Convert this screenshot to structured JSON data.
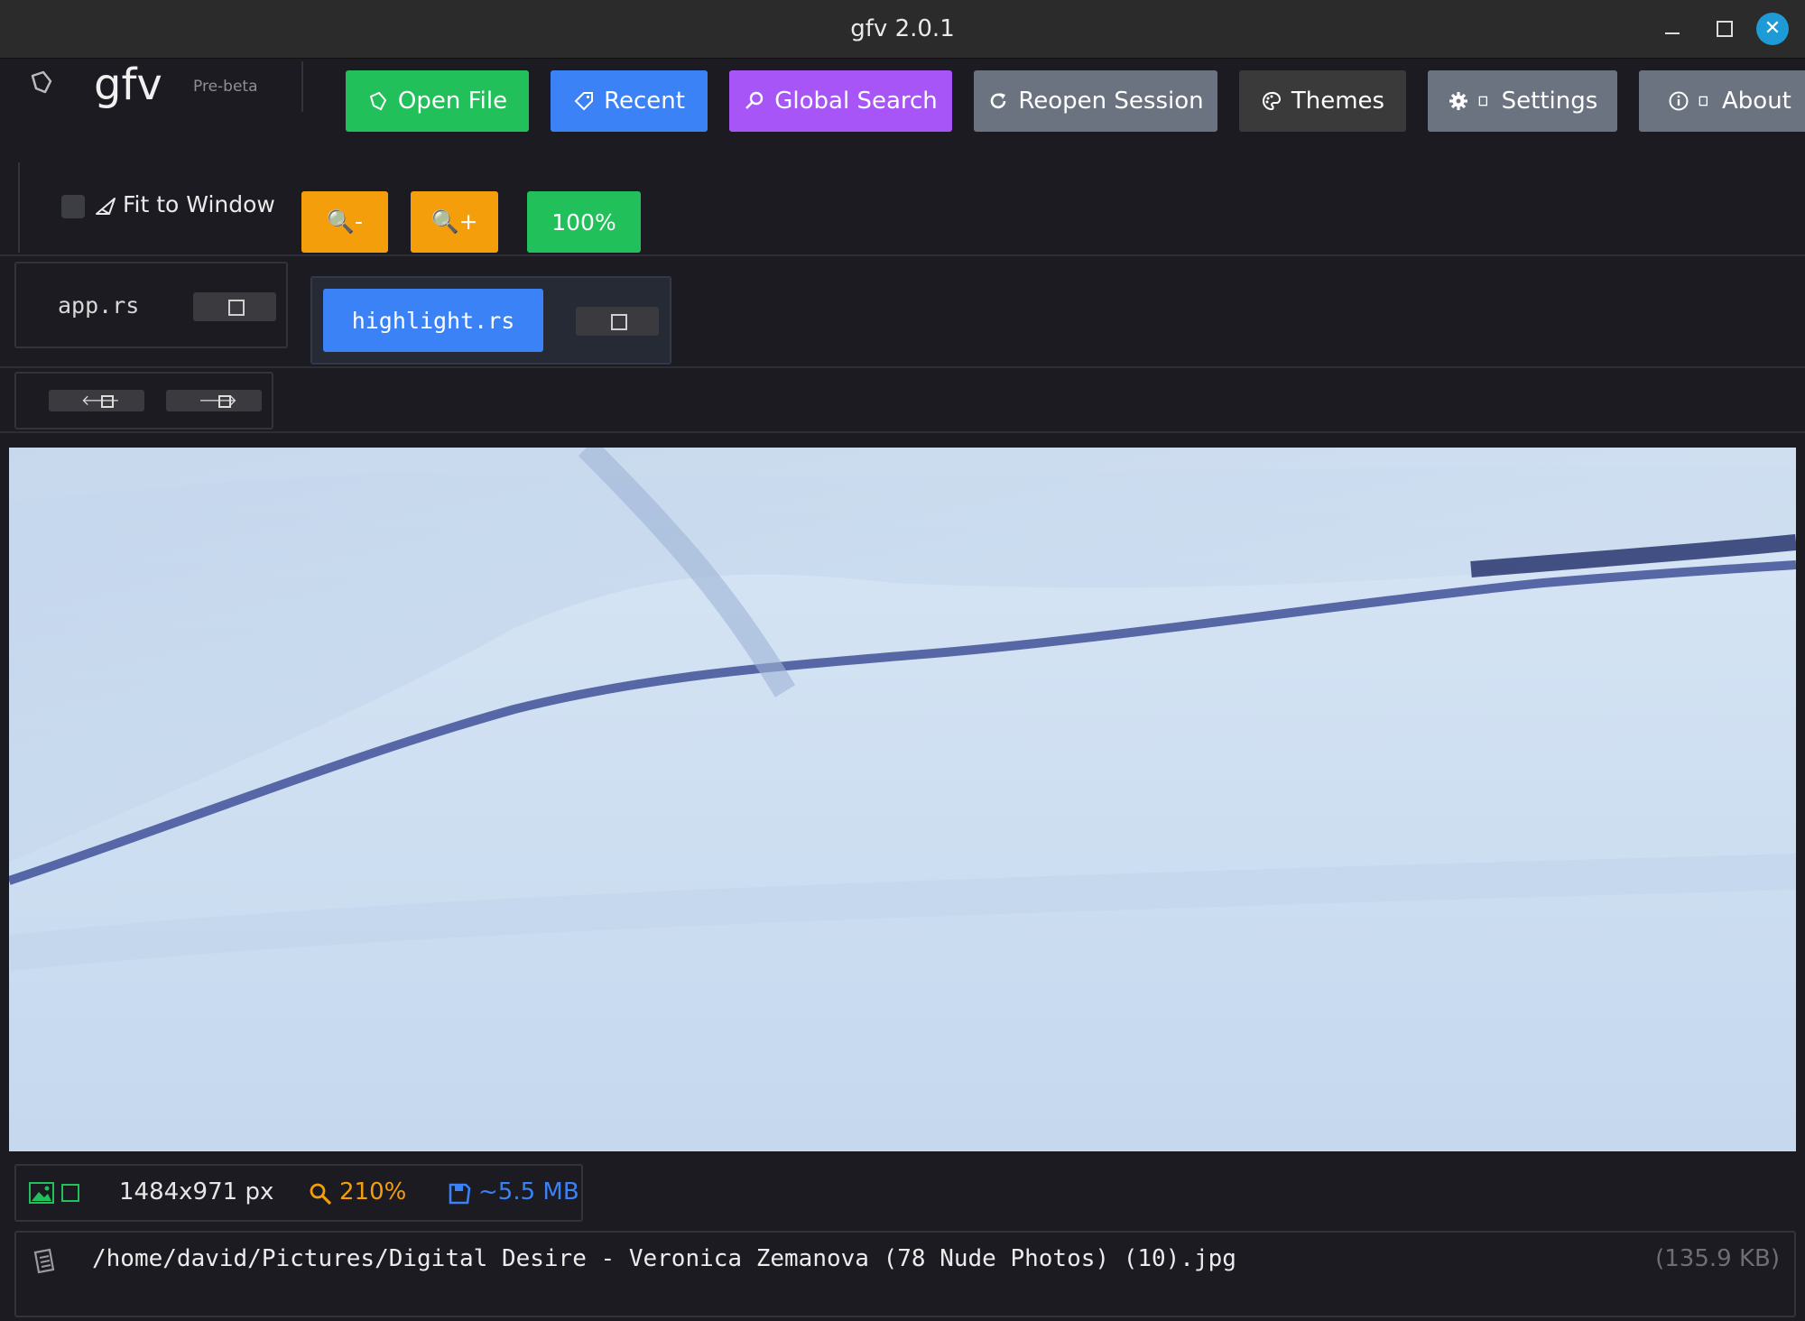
{
  "window": {
    "title": "gfv 2.0.1",
    "close_glyph": "✕"
  },
  "brand": {
    "name": "gfv",
    "badge": "Pre-beta",
    "icon": "hand-icon"
  },
  "toolbar": {
    "open_file": "Open File",
    "recent": "Recent",
    "global_search": "Global Search",
    "reopen_session": "Reopen Session",
    "themes": "Themes",
    "settings": "Settings",
    "about": "About"
  },
  "view": {
    "fit_label": "Fit to Window",
    "fit_checked": false,
    "zoom_out": "🔍-",
    "zoom_in": "🔍+",
    "zoom_reset": "100%"
  },
  "tabs": [
    {
      "name": "app.rs",
      "active": false
    },
    {
      "name": "highlight.rs",
      "active": true
    }
  ],
  "nav": {
    "prev_glyph": "🡐",
    "next_glyph": "🡒"
  },
  "status": {
    "dimensions": "1484x971 px",
    "zoom": "210%",
    "memory": "~5.5 MB"
  },
  "file": {
    "path": "/home/david/Pictures/Digital Desire - Veronica Zemanova (78 Nude Photos) (10).jpg",
    "size": "(135.9 KB)"
  },
  "colors": {
    "green": "#22c05a",
    "blue": "#3b82f6",
    "purple": "#a855f7",
    "gray": "#6b7280",
    "orange": "#f59e0b",
    "dark": "#1b1b21"
  }
}
